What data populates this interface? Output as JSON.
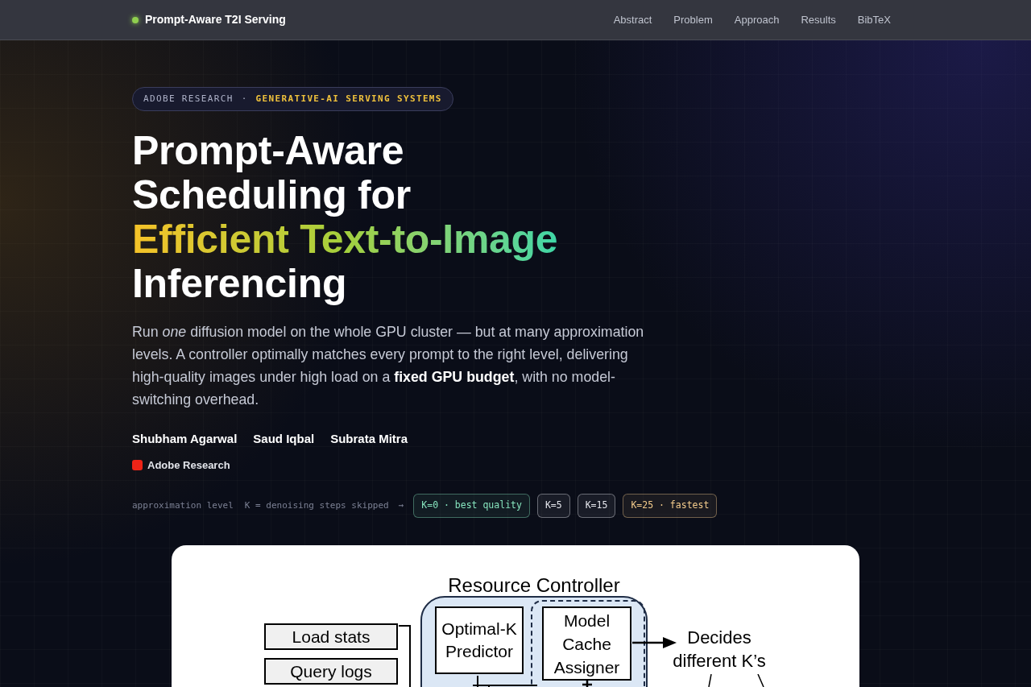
{
  "nav": {
    "brand": "Prompt-Aware T2I Serving",
    "links": [
      "Abstract",
      "Problem",
      "Approach",
      "Results",
      "BibTeX"
    ]
  },
  "hero": {
    "badge": {
      "org": "ADOBE RESEARCH",
      "separator": "·",
      "topic": "GENERATIVE-AI SERVING SYSTEMS"
    },
    "title_lines": [
      {
        "text": "Prompt-Aware",
        "kind": "plain"
      },
      {
        "text": "Scheduling for",
        "kind": "plain"
      },
      {
        "text": "Efficient Text-to-Image",
        "kind": "gradient"
      },
      {
        "text": "Inferencing",
        "kind": "plain"
      }
    ],
    "summary": "Run *one* diffusion model on the whole GPU cluster — but at many approximation levels. A controller optimally matches every prompt to the right level, delivering high-quality images under high load on a **fixed GPU budget**, with no model-switching overhead.",
    "authors": [
      "Shubham Agarwal",
      "Saud Iqbal",
      "Subrata Mitra"
    ],
    "affiliation": "Adobe Research",
    "levels": {
      "label": "approximation level",
      "legend": "K = denoising steps skipped",
      "arrow": "→",
      "chips": [
        {
          "text": "K=0 · best quality",
          "color": "#86e3bd"
        },
        {
          "text": "K=5",
          "color": "#e4e6ec"
        },
        {
          "text": "K=15",
          "color": "#e4e6ec"
        },
        {
          "text": "K=25 · fastest",
          "color": "#f3cb8c"
        }
      ]
    }
  },
  "figure": {
    "title": "Resource Controller",
    "inputs": [
      "Load stats",
      "Query logs"
    ],
    "predictor": "Optimal-K Predictor",
    "assigner": "Model Cache Assigner",
    "output": "Decides different K’s"
  }
}
